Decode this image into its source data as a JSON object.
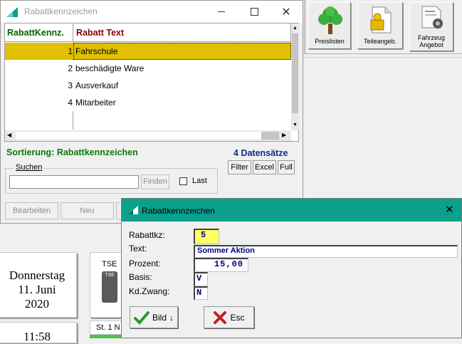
{
  "toolbar": {
    "preislisten": "Preislisten",
    "teileangeb": "Teileangeb.",
    "fahrzeug_angebot_1": "Fahrzeug",
    "fahrzeug_angebot_2": "Angebot"
  },
  "bg": {
    "date_weekday": "Donnerstag",
    "date_day": "11. Juni",
    "date_year": "2020",
    "time": "11:58",
    "tse": "TSE",
    "tse_icon_text": "TSE",
    "status": "St. 1 N"
  },
  "win1": {
    "title": "Rabattkennzeichen",
    "columns": [
      "RabattKennz.",
      "Rabatt Text"
    ],
    "rows": [
      {
        "num": "1",
        "text": "Fahrschule",
        "selected": true
      },
      {
        "num": "2",
        "text": "beschädigte Ware",
        "selected": false
      },
      {
        "num": "3",
        "text": "Ausverkauf",
        "selected": false
      },
      {
        "num": "4",
        "text": "Mitarbeiter",
        "selected": false
      }
    ],
    "sort_label": "Sortierung: Rabattkennzeichen",
    "records": "4 Datensätze",
    "filter": "Filter",
    "excel": "Excel",
    "full": "Full",
    "search_group": "Suchen",
    "search_value": "",
    "find": "Finden",
    "last": "Last",
    "edit": "Bearbeiten",
    "new": "Neu"
  },
  "win2": {
    "title": "Rabattkennzeichen",
    "labels": {
      "rabattkz": "Rabattkz:",
      "text": "Text:",
      "prozent": "Prozent:",
      "basis": "Basis:",
      "kdzwang": "Kd.Zwang:"
    },
    "values": {
      "rabattkz": "5",
      "text": "Sommer Aktion",
      "prozent": "15,00",
      "basis": "V",
      "kdzwang": "N"
    },
    "bild": "Bild",
    "esc": "Esc"
  },
  "colors": {
    "selection": "#e0c000",
    "header_green": "#006400",
    "dialog_title": "#0aa08c"
  }
}
